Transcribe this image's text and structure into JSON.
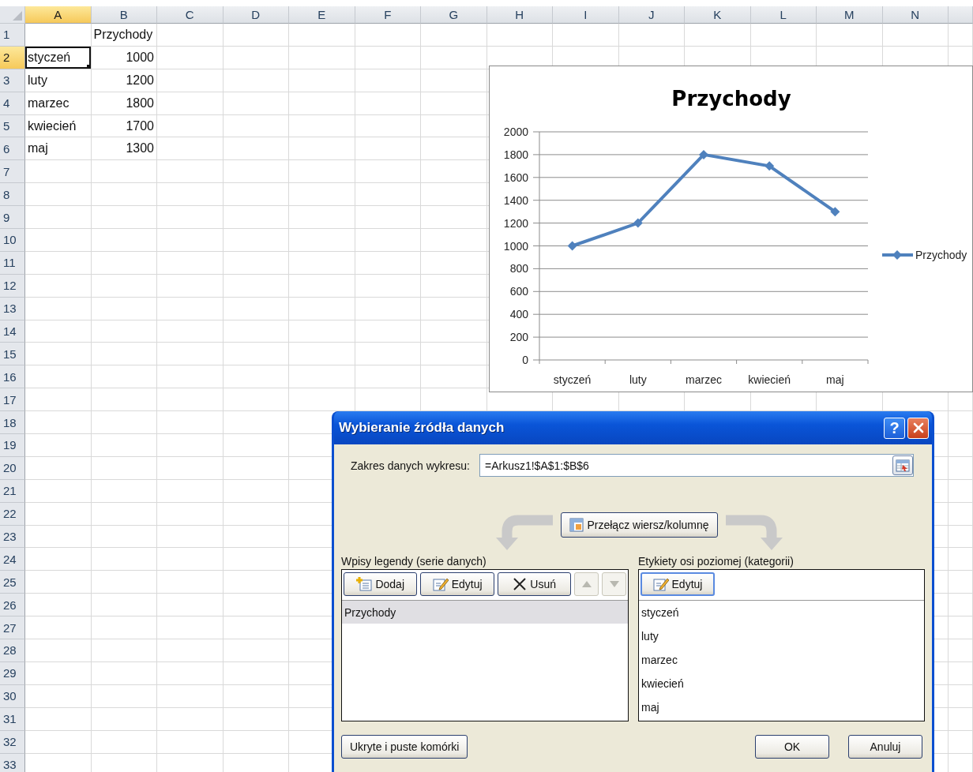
{
  "sheet": {
    "columns": [
      {
        "label": "A",
        "selected": true
      },
      {
        "label": "B",
        "selected": false
      },
      {
        "label": "C",
        "selected": false
      },
      {
        "label": "D",
        "selected": false
      },
      {
        "label": "E",
        "selected": false
      },
      {
        "label": "F",
        "selected": false
      },
      {
        "label": "G",
        "selected": false
      },
      {
        "label": "H",
        "selected": false
      },
      {
        "label": "I",
        "selected": false
      },
      {
        "label": "J",
        "selected": false
      },
      {
        "label": "K",
        "selected": false
      },
      {
        "label": "L",
        "selected": false
      },
      {
        "label": "M",
        "selected": false
      },
      {
        "label": "N",
        "selected": false
      }
    ],
    "rows": [
      {
        "label": "1",
        "selected": false,
        "cells": [
          null,
          {
            "text": "Przychody",
            "kind": "text",
            "selected": false
          }
        ]
      },
      {
        "label": "2",
        "selected": true,
        "cells": [
          {
            "text": "styczeń",
            "kind": "text",
            "selected": true
          },
          {
            "text": "1000",
            "kind": "number",
            "selected": false
          }
        ]
      },
      {
        "label": "3",
        "selected": false,
        "cells": [
          {
            "text": "luty",
            "kind": "text",
            "selected": false
          },
          {
            "text": "1200",
            "kind": "number",
            "selected": false
          }
        ]
      },
      {
        "label": "4",
        "selected": false,
        "cells": [
          {
            "text": "marzec",
            "kind": "text",
            "selected": false
          },
          {
            "text": "1800",
            "kind": "number",
            "selected": false
          }
        ]
      },
      {
        "label": "5",
        "selected": false,
        "cells": [
          {
            "text": "kwiecień",
            "kind": "text",
            "selected": false
          },
          {
            "text": "1700",
            "kind": "number",
            "selected": false
          }
        ]
      },
      {
        "label": "6",
        "selected": false,
        "cells": [
          {
            "text": "maj",
            "kind": "text",
            "selected": false
          },
          {
            "text": "1300",
            "kind": "number",
            "selected": false
          }
        ]
      },
      {
        "label": "7",
        "selected": false
      },
      {
        "label": "8",
        "selected": false
      },
      {
        "label": "9",
        "selected": false
      },
      {
        "label": "10",
        "selected": false
      },
      {
        "label": "11",
        "selected": false
      },
      {
        "label": "12",
        "selected": false
      },
      {
        "label": "13",
        "selected": false
      },
      {
        "label": "14",
        "selected": false
      },
      {
        "label": "15",
        "selected": false
      },
      {
        "label": "16",
        "selected": false
      },
      {
        "label": "17",
        "selected": false
      },
      {
        "label": "18",
        "selected": false
      },
      {
        "label": "19",
        "selected": false
      },
      {
        "label": "20",
        "selected": false
      },
      {
        "label": "21",
        "selected": false
      },
      {
        "label": "22",
        "selected": false
      },
      {
        "label": "23",
        "selected": false
      },
      {
        "label": "24",
        "selected": false
      },
      {
        "label": "25",
        "selected": false
      },
      {
        "label": "26",
        "selected": false
      },
      {
        "label": "27",
        "selected": false
      },
      {
        "label": "28",
        "selected": false
      },
      {
        "label": "29",
        "selected": false
      },
      {
        "label": "30",
        "selected": false
      },
      {
        "label": "31",
        "selected": false
      },
      {
        "label": "32",
        "selected": false
      },
      {
        "label": "33",
        "selected": false
      }
    ]
  },
  "chart": {
    "chart_data": {
      "type": "line",
      "title": "Przychody",
      "categories": [
        "styczeń",
        "luty",
        "marzec",
        "kwiecień",
        "maj"
      ],
      "series": [
        {
          "name": "Przychody",
          "color": "#4f81bd",
          "marker": "diamond",
          "values": [
            1000,
            1200,
            1800,
            1700,
            1300
          ]
        }
      ],
      "grid": true,
      "ylim": [
        0,
        2000
      ],
      "yticks": [
        0,
        200,
        400,
        600,
        800,
        1000,
        1200,
        1400,
        1600,
        1800,
        2000
      ]
    }
  },
  "dialog": {
    "title": "Wybieranie źródła danych",
    "help_button": "?",
    "range": {
      "label": "Zakres danych wykresu:",
      "value": "=Arkusz1!$A$1:$B$6"
    },
    "switch_button": "Przełącz wiersz/kolumnę",
    "legend_entries": {
      "label": "Wpisy legendy (serie danych)",
      "buttons": [
        {
          "label": "Dodaj",
          "kind": "add"
        },
        {
          "label": "Edytuj",
          "kind": "edit"
        },
        {
          "label": "Usuń",
          "kind": "remove"
        }
      ],
      "move_up": {
        "disabled": true
      },
      "move_down": {
        "disabled": true
      },
      "items": [
        {
          "label": "Przychody",
          "selected": true
        }
      ]
    },
    "axis_labels": {
      "label": "Etykiety osi poziomej (kategorii)",
      "edit_button": "Edytuj",
      "items": [
        {
          "label": "styczeń"
        },
        {
          "label": "luty"
        },
        {
          "label": "marzec"
        },
        {
          "label": "kwiecień"
        },
        {
          "label": "maj"
        }
      ]
    },
    "hidden_cells_button": "Ukryte i puste komórki",
    "ok_button": "OK",
    "cancel_button": "Anuluj"
  }
}
